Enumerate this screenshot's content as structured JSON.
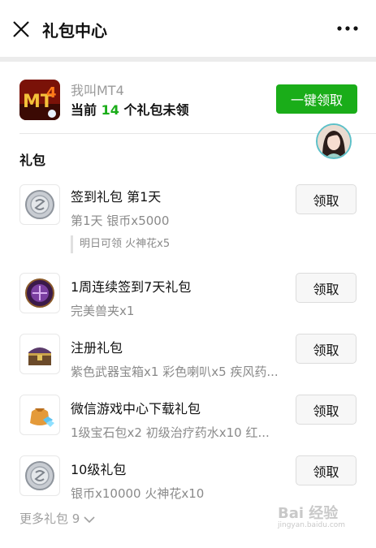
{
  "header": {
    "title": "礼包中心"
  },
  "game": {
    "name": "我叫MT4",
    "status_prefix": "当前",
    "count": "14",
    "status_suffix": "个礼包未领",
    "claim_all_label": "一键领取"
  },
  "section": {
    "title": "礼包"
  },
  "gifts": [
    {
      "title": "签到礼包 第1天",
      "desc": "第1天 银币x5000",
      "note": "明日可领 火神花x5",
      "button": "领取",
      "icon": "silver-coin-icon"
    },
    {
      "title": "1周连续签到7天礼包",
      "desc": "完美兽夹x1",
      "button": "领取",
      "icon": "beast-trap-icon"
    },
    {
      "title": "注册礼包",
      "desc": "紫色武器宝箱x1 彩色喇叭x5 疾风药...",
      "button": "领取",
      "icon": "treasure-chest-icon"
    },
    {
      "title": "微信游戏中心下载礼包",
      "desc": "1级宝石包x2 初级治疗药水x10 红...",
      "button": "领取",
      "icon": "gem-bag-icon"
    },
    {
      "title": "10级礼包",
      "desc": "银币x10000 火神花x10",
      "button": "领取",
      "icon": "silver-coin-icon"
    }
  ],
  "footer": {
    "more_label": "更多礼包 9"
  },
  "watermark": {
    "text": "Bai 经验",
    "sub": "jingyan.baidu.com"
  },
  "colors": {
    "accent": "#1aad19",
    "muted": "#8a8a8a"
  }
}
